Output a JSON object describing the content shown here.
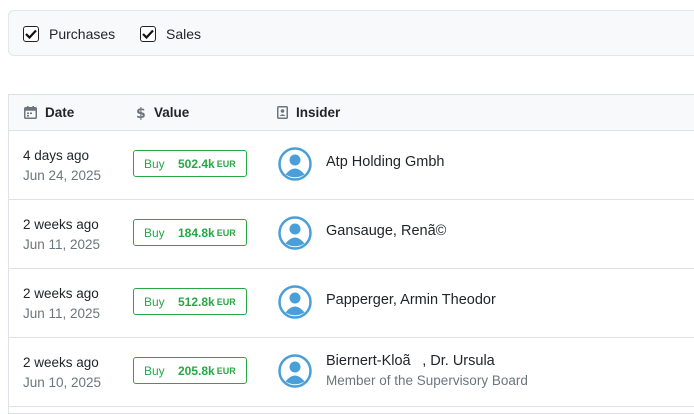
{
  "filters": {
    "purchases": {
      "label": "Purchases",
      "checked": true
    },
    "sales": {
      "label": "Sales",
      "checked": true
    }
  },
  "table": {
    "columns": {
      "date": {
        "label": "Date",
        "icon": "calendar-icon"
      },
      "value": {
        "label": "Value",
        "icon": "dollar-icon"
      },
      "insider": {
        "label": "Insider",
        "icon": "id-card-icon"
      }
    },
    "rows": [
      {
        "relative": "4 days ago",
        "date": "Jun 24, 2025",
        "type": "Buy",
        "amount": "502.4k",
        "currency": "EUR",
        "name": "Atp Holding Gmbh",
        "role": ""
      },
      {
        "relative": "2 weeks ago",
        "date": "Jun 11, 2025",
        "type": "Buy",
        "amount": "184.8k",
        "currency": "EUR",
        "name": "Gansauge, Renã©",
        "role": ""
      },
      {
        "relative": "2 weeks ago",
        "date": "Jun 11, 2025",
        "type": "Buy",
        "amount": "512.8k",
        "currency": "EUR",
        "name": "Papperger, Armin Theodor",
        "role": ""
      },
      {
        "relative": "2 weeks ago",
        "date": "Jun 10, 2025",
        "type": "Buy",
        "amount": "205.8k",
        "currency": "EUR",
        "name": "Biernert-Kloã, Dr. Ursula",
        "role": "Member of the Supervisory Board"
      }
    ]
  },
  "colors": {
    "buy": "#28a745",
    "avatar": "#4a9fd8",
    "muted": "#6c757d"
  }
}
